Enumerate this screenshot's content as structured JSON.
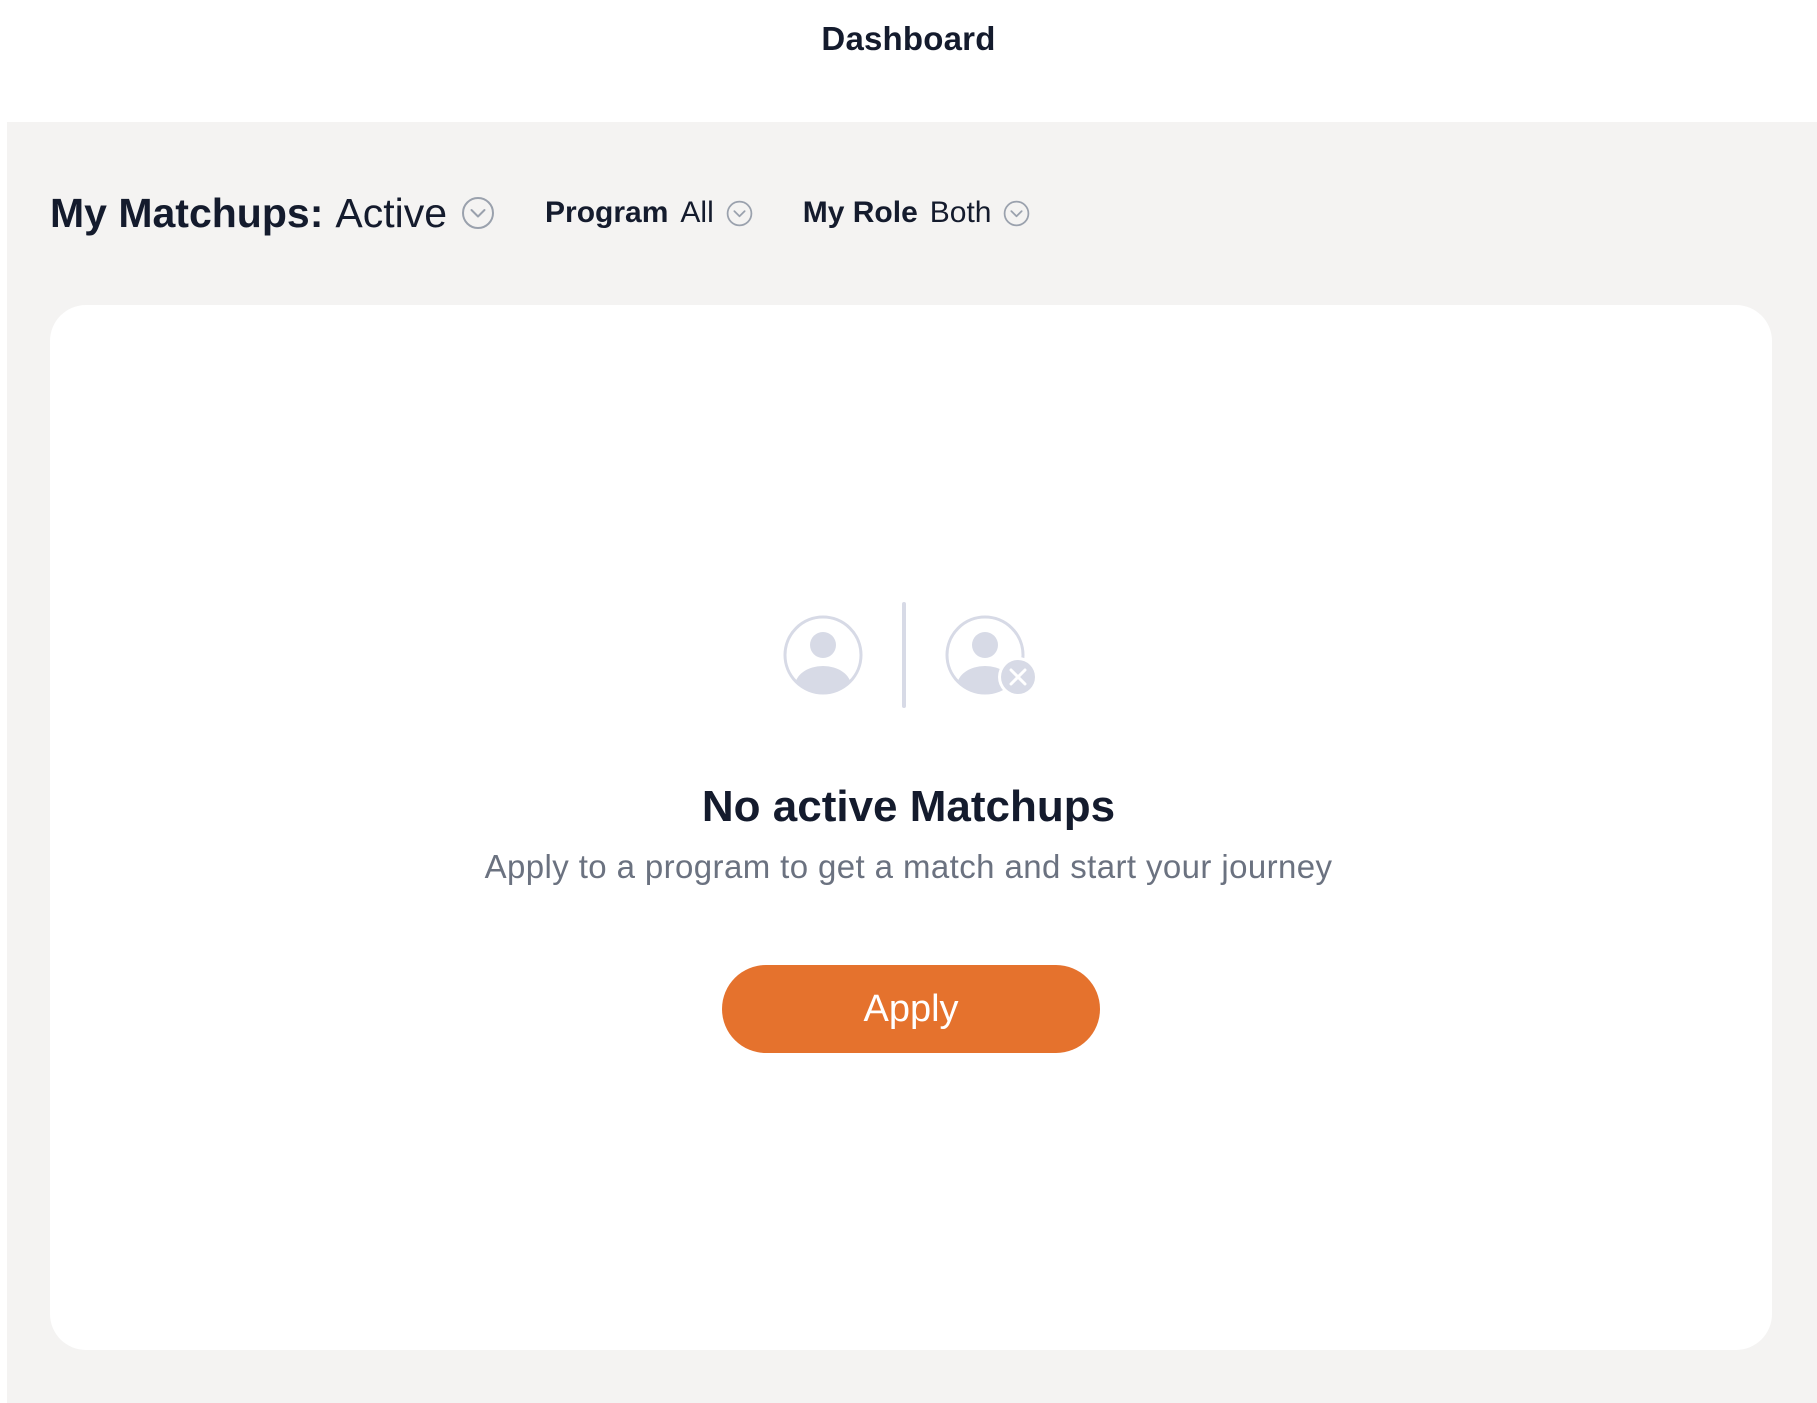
{
  "header": {
    "title": "Dashboard"
  },
  "filters": {
    "matchups": {
      "label": "My Matchups:",
      "value": "Active",
      "icon": "chevron-down-circle-icon"
    },
    "program": {
      "label": "Program",
      "value": "All",
      "icon": "chevron-down-circle-icon"
    },
    "role": {
      "label": "My Role",
      "value": "Both",
      "icon": "chevron-down-circle-icon"
    }
  },
  "empty_state": {
    "icons": [
      "user-avatar-icon",
      "divider",
      "user-remove-icon"
    ],
    "title": "No active Matchups",
    "subtitle": "Apply to a program to get a match and start your journey",
    "button_label": "Apply"
  },
  "colors": {
    "accent": "#e5722d",
    "background": "#f4f3f2",
    "card": "#ffffff",
    "text_primary": "#141b2d",
    "text_secondary": "#6b7280",
    "icon_muted": "#d7dae6"
  }
}
